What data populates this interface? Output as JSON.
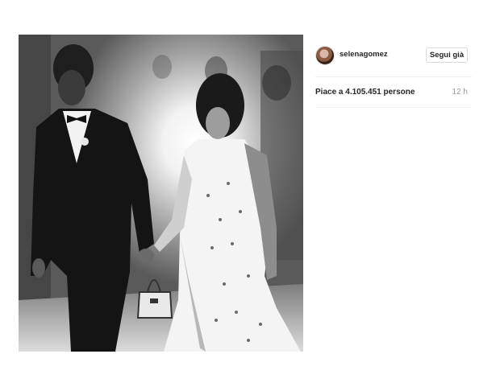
{
  "post": {
    "username": "selenagomez",
    "follow_label": "Segui già",
    "likes_text": "Piace a 4.105.451 persone",
    "time_ago": "12 h"
  },
  "icons": {
    "avatar": "profile-avatar"
  }
}
